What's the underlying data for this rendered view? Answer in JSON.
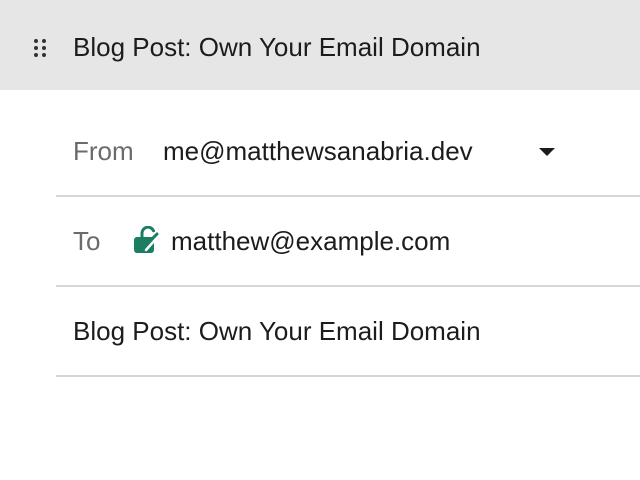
{
  "window": {
    "title": "Blog Post: Own Your Email Domain"
  },
  "icons": {
    "drag": "drag-handle-icon",
    "lock": "lock-open-icon",
    "dropdown": "chevron-down-icon"
  },
  "colors": {
    "titlebar_bg": "#e6e6e6",
    "lock_accent": "#1b7d62",
    "label_gray": "#6b6b6b",
    "divider": "#d6d6d6"
  },
  "compose": {
    "from": {
      "label": "From",
      "value": "me@matthewsanabria.dev"
    },
    "to": {
      "label": "To",
      "recipient": "matthew@example.com"
    },
    "subject": {
      "value": "Blog Post: Own Your Email Domain"
    }
  }
}
